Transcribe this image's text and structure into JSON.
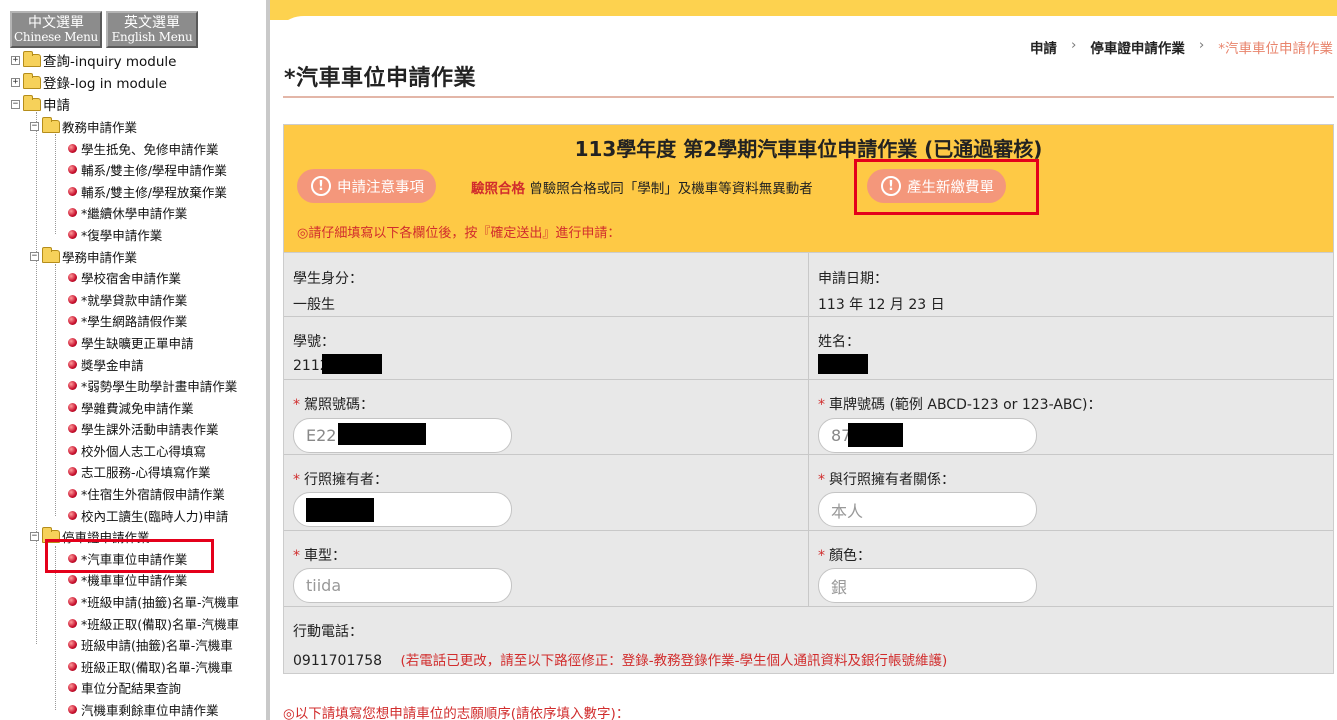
{
  "sidebar": {
    "menu_buttons": [
      {
        "zh": "中文選單",
        "en": "Chinese Menu"
      },
      {
        "zh": "英文選單",
        "en": "English Menu"
      }
    ],
    "tree": [
      {
        "label": "查詢-inquiry module"
      },
      {
        "label": "登錄-log in module"
      },
      {
        "label": "申請"
      },
      {
        "label": "教務申請作業"
      },
      {
        "label": "學生抵免、免修申請作業"
      },
      {
        "label": "輔系/雙主修/學程申請作業"
      },
      {
        "label": "輔系/雙主修/學程放棄作業"
      },
      {
        "label": "*繼續休學申請作業"
      },
      {
        "label": "*復學申請作業"
      },
      {
        "label": "學務申請作業"
      },
      {
        "label": "學校宿舍申請作業"
      },
      {
        "label": "*就學貸款申請作業"
      },
      {
        "label": "*學生網路請假作業"
      },
      {
        "label": "學生缺曠更正單申請"
      },
      {
        "label": "獎學金申請"
      },
      {
        "label": "*弱勢學生助學計畫申請作業"
      },
      {
        "label": "學雜費減免申請作業"
      },
      {
        "label": "學生課外活動申請表作業"
      },
      {
        "label": "校外個人志工心得填寫"
      },
      {
        "label": "志工服務-心得填寫作業"
      },
      {
        "label": "*住宿生外宿請假申請作業"
      },
      {
        "label": "校內工讀生(臨時人力)申請"
      },
      {
        "label": "停車證申請作業"
      },
      {
        "label": "*汽車車位申請作業"
      },
      {
        "label": "*機車車位申請作業"
      },
      {
        "label": "*班級申請(抽籤)名單-汽機車"
      },
      {
        "label": "*班級正取(備取)名單-汽機車"
      },
      {
        "label": "班級申請(抽籤)名單-汽機車"
      },
      {
        "label": "班級正取(備取)名單-汽機車"
      },
      {
        "label": "車位分配結果查詢"
      },
      {
        "label": "汽機車剩餘車位申請作業"
      }
    ]
  },
  "breadcrumb": {
    "items": [
      "申請",
      "停車證申請作業"
    ],
    "separator": "›",
    "current": "*汽車車位申請作業"
  },
  "page_title": "*汽車車位申請作業",
  "panel": {
    "title": "113學年度 第2學期汽車車位申請作業 (已通過審核)",
    "notice_button": "申請注意事項",
    "notice_highlight": "驗照合格",
    "notice_text": " 曾驗照合格或同「學制」及機車等資料無異動者",
    "generate_button": "產生新繳費單",
    "instruction": "◎請仔細填寫以下各欄位後，按『確定送出』進行申請："
  },
  "form": {
    "identity_label": "學生身分：",
    "identity_value": "一般生",
    "date_label": "申請日期：",
    "date_value": "113 年 12 月 23 日",
    "student_id_label": "學號：",
    "student_id_value": "2112",
    "name_label": "姓名：",
    "license_label": "駕照號碼：",
    "license_value": "E22",
    "plate_label": "車牌號碼 (範例 ABCD-123 or 123-ABC)：",
    "plate_value": "87",
    "owner_label": "行照擁有者：",
    "relation_label": "與行照擁有者關係：",
    "relation_placeholder": "本人",
    "car_type_label": "車型：",
    "car_type_placeholder": "tiida",
    "color_label": "顏色：",
    "color_placeholder": "銀",
    "required_mark": "*",
    "phone_label": "行動電話：",
    "phone_value": "0911701758",
    "phone_note": "(若電話已更改，請至以下路徑修正：登錄-教務登錄作業-學生個人通訊資料及銀行帳號維護)"
  },
  "footer_note": "◎以下請填寫您想申請車位的志願順序(請依序填入數字)：",
  "colors": {
    "accent_yellow": "#fec945",
    "pill_salmon": "#f4977b",
    "highlight_red": "#d12d2d",
    "selection_box": "#e4001b"
  }
}
